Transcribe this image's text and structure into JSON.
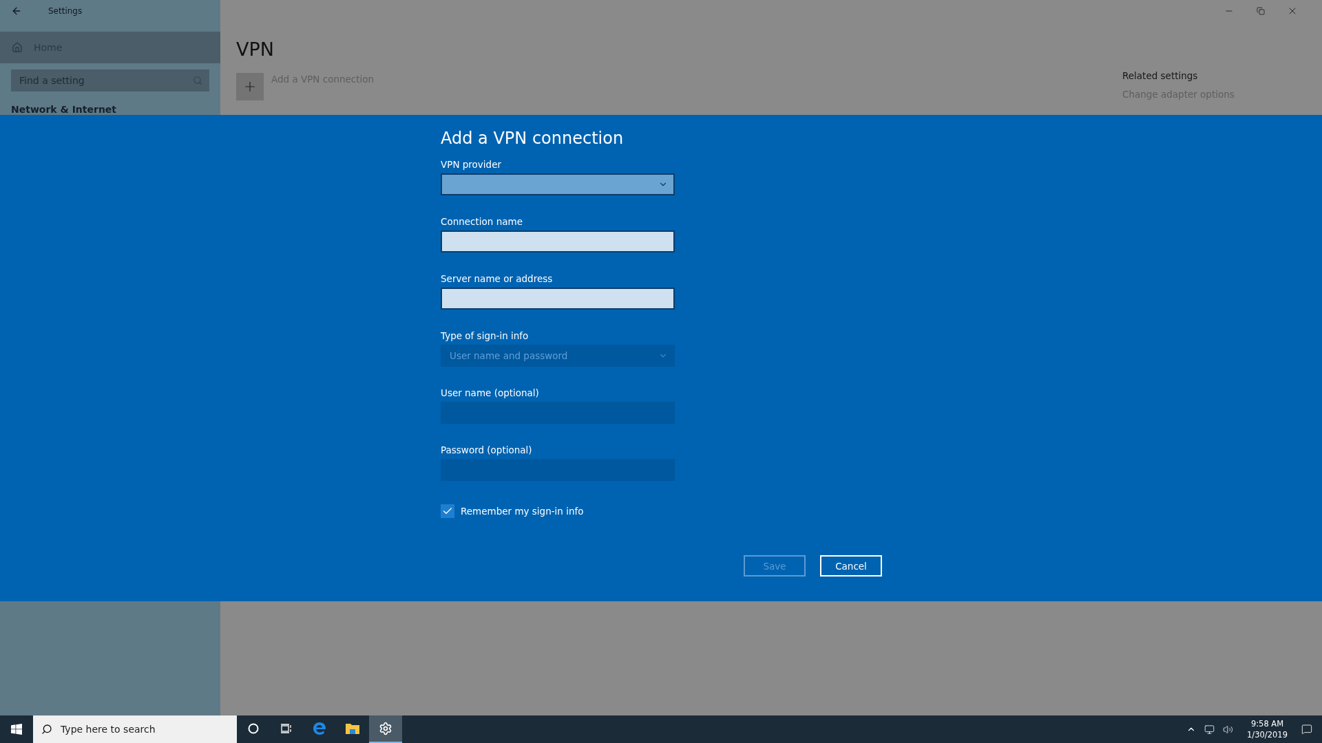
{
  "window": {
    "title": "Settings"
  },
  "sidebar": {
    "home": "Home",
    "search": {
      "placeholder": "Find a setting"
    },
    "section": "Network & Internet"
  },
  "page": {
    "title": "VPN",
    "add_label": "Add a VPN connection",
    "related": {
      "heading": "Related settings",
      "link": "Change adapter options"
    }
  },
  "dialog": {
    "title": "Add a VPN connection",
    "fields": [
      {
        "kind": "dropdown",
        "label": "VPN provider",
        "disabled": false
      },
      {
        "kind": "text",
        "label": "Connection name",
        "disabled": false
      },
      {
        "kind": "text",
        "label": "Server name or address",
        "disabled": false
      },
      {
        "kind": "dropdown",
        "label": "Type of sign-in info",
        "value": "User name and password",
        "disabled": true
      },
      {
        "kind": "text",
        "label": "User name (optional)",
        "disabled": true
      },
      {
        "kind": "password",
        "label": "Password (optional)",
        "disabled": true
      }
    ],
    "remember": {
      "label": "Remember my sign-in info",
      "checked": true
    },
    "buttons": [
      {
        "label": "Save",
        "disabled": true
      },
      {
        "label": "Cancel",
        "disabled": false
      }
    ]
  },
  "taskbar": {
    "search": {
      "placeholder": "Type here to search"
    },
    "apps": [
      {
        "kind": "cortana",
        "selected": false
      },
      {
        "kind": "taskview",
        "selected": false
      },
      {
        "kind": "edge",
        "selected": false
      },
      {
        "kind": "explorer",
        "selected": false
      },
      {
        "kind": "settings",
        "selected": true
      }
    ],
    "clock": {
      "time": "9:58 AM",
      "date": "1/30/2019"
    }
  }
}
